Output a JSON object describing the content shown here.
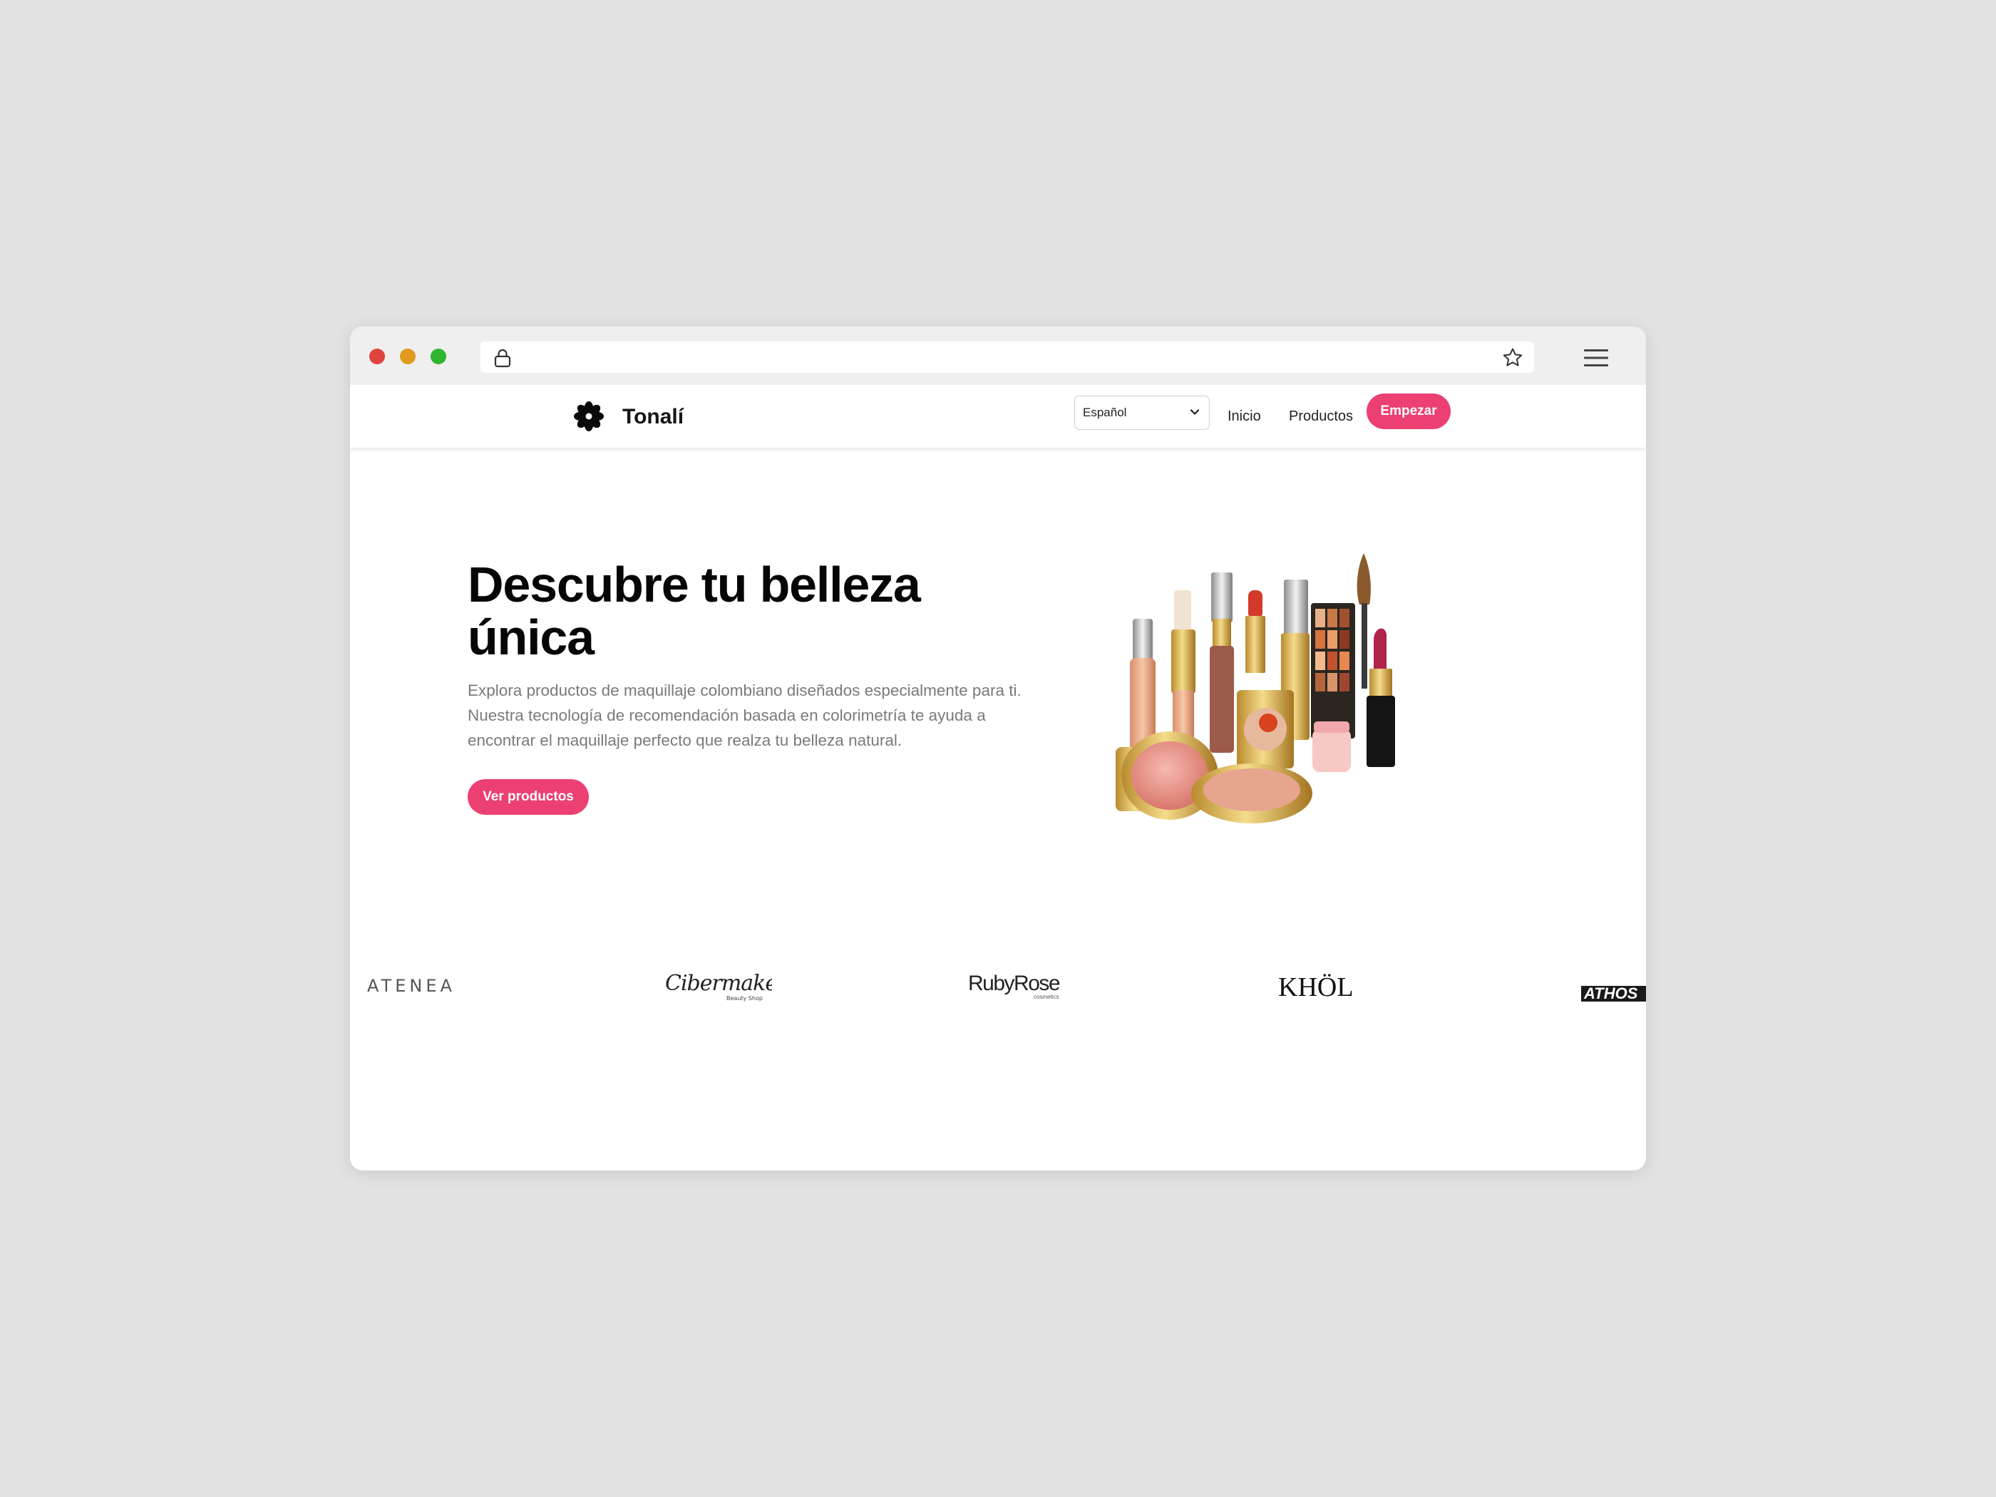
{
  "browser": {
    "address": "",
    "icons": [
      "lock-icon",
      "bookmark-star-icon",
      "hamburger-menu-icon"
    ]
  },
  "nav": {
    "brand": "Tonalí",
    "language_select": "Español",
    "links": [
      "Inicio",
      "Productos"
    ],
    "cta": "Empezar"
  },
  "hero": {
    "title_line1": "Descubre tu belleza",
    "title_line2": "única",
    "description": "Explora productos de maquillaje colombiano diseñados especialmente para ti. Nuestra tecnología de recomendación basada en colorimetría te ayuda a encontrar el maquillaje perfecto que realza tu belleza natural.",
    "cta": "Ver productos"
  },
  "brands": {
    "atenea": "ATENEA",
    "cibermake": "Cibermake",
    "cibermake_sub": "Beauty Shop",
    "rubyrose": "RubyRose",
    "rubyrose_sub": "cosmetics",
    "khol": "KHÖL",
    "athos": "ATHOS"
  },
  "colors": {
    "accent": "#ec3f72",
    "background": "#e2e2e2",
    "window": "#ffffff",
    "text_dark": "#060606",
    "text_muted": "#7a7a7a"
  }
}
